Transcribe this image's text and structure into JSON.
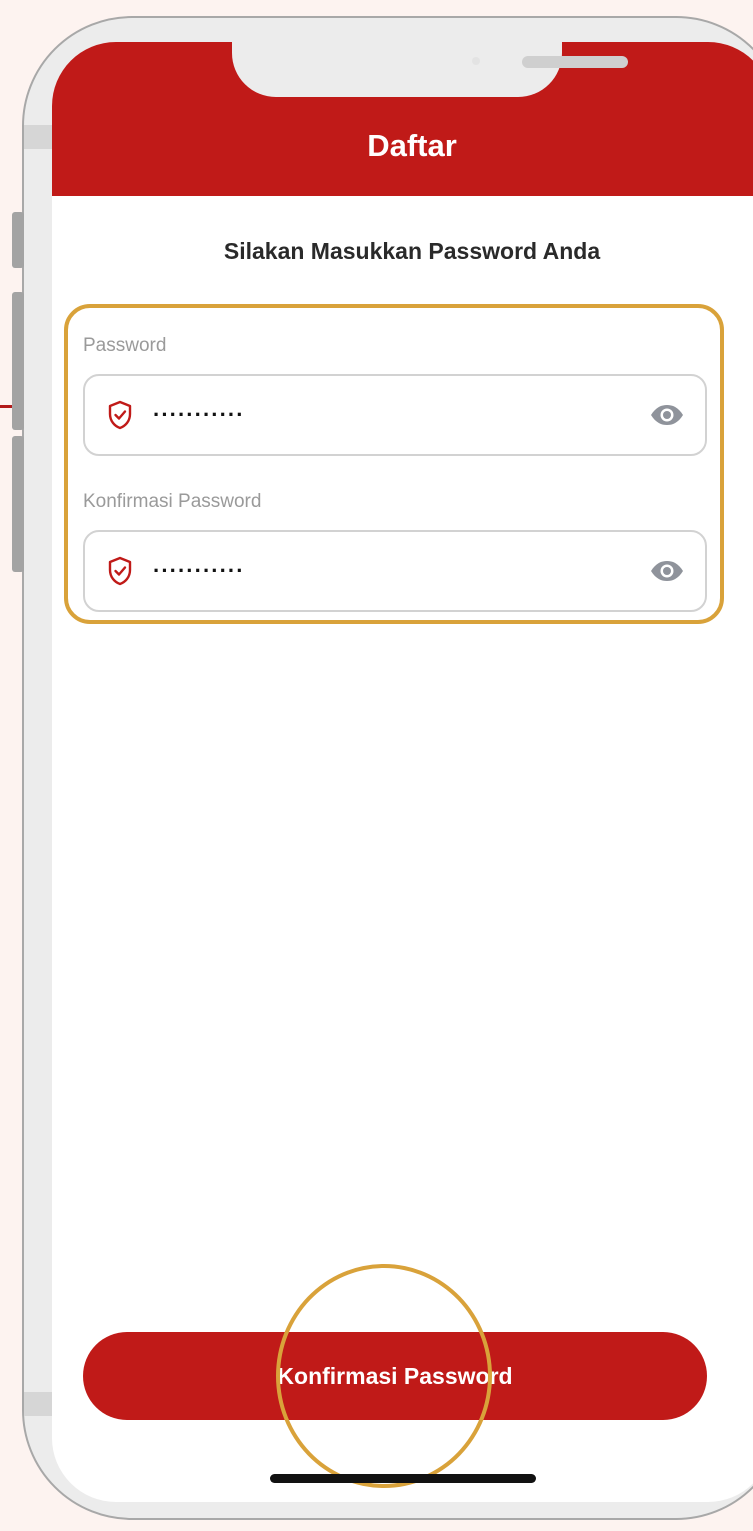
{
  "header": {
    "title": "Daftar"
  },
  "form": {
    "subtitle": "Silakan Masukkan Password Anda",
    "password": {
      "label": "Password",
      "value": "···········",
      "icon": "shield-check-icon"
    },
    "confirm_password": {
      "label": "Konfirmasi Password",
      "value": "···········",
      "icon": "shield-check-icon"
    },
    "toggle_icon": "eye-icon"
  },
  "actions": {
    "confirm_label": "Konfirmasi Password"
  },
  "colors": {
    "primary": "#c01a18",
    "highlight": "#d9a23a",
    "label": "#9a9a9a"
  }
}
